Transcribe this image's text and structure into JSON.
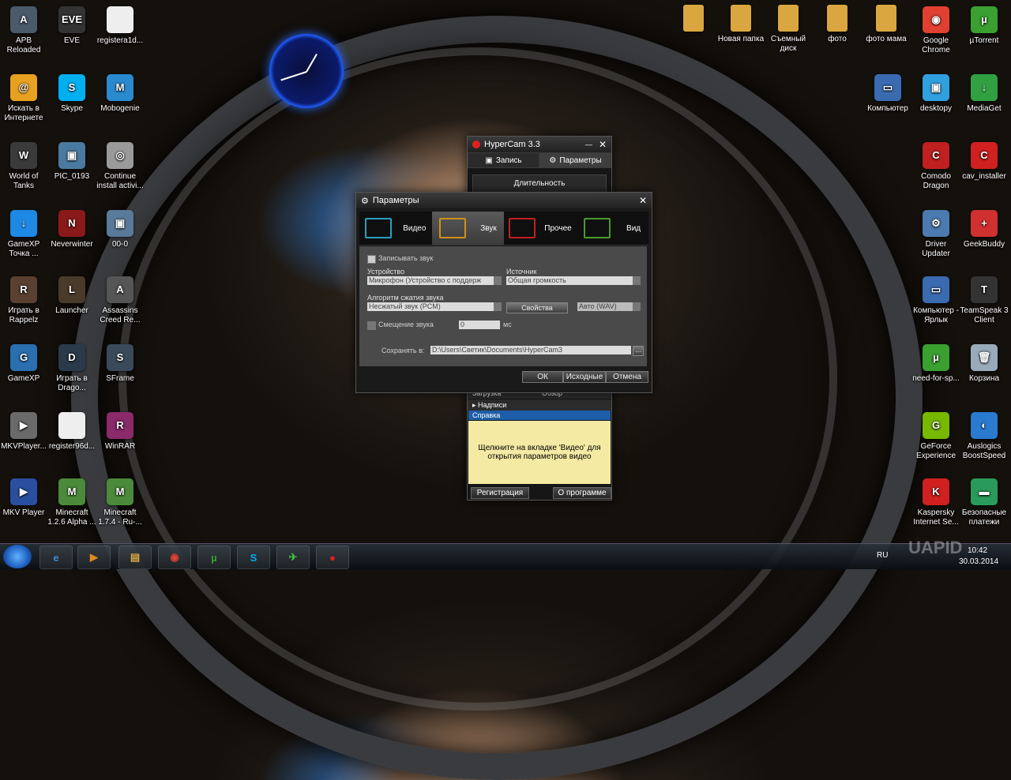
{
  "desktop": {
    "icons_left": [
      {
        "label": "APB Reloaded",
        "color": "#4a5a6a",
        "glyph": "A"
      },
      {
        "label": "Искать в Интернете",
        "color": "#e8a020",
        "glyph": "@"
      },
      {
        "label": "World of Tanks",
        "color": "#3a3a3a",
        "glyph": "W"
      },
      {
        "label": "GameXP Точка ...",
        "color": "#1e88e5",
        "glyph": "↓"
      },
      {
        "label": "Играть в Rappelz",
        "color": "#5a4030",
        "glyph": "R"
      },
      {
        "label": "GameXP",
        "color": "#2a6fb0",
        "glyph": "G"
      },
      {
        "label": "MKVPlayer...",
        "color": "#6a6a6a",
        "glyph": "▶"
      },
      {
        "label": "MKV Player",
        "color": "#2a4fa0",
        "glyph": "▶"
      }
    ],
    "icons_col2": [
      {
        "label": "EVE",
        "color": "#333",
        "glyph": "EVE"
      },
      {
        "label": "Skype",
        "color": "#00aff0",
        "glyph": "S"
      },
      {
        "label": "PIC_0193",
        "color": "#4a7aa0",
        "glyph": "▣"
      },
      {
        "label": "Neverwinter",
        "color": "#8a1a1a",
        "glyph": "N"
      },
      {
        "label": "Launcher",
        "color": "#4a3a2a",
        "glyph": "L"
      },
      {
        "label": "Играть в Drago...",
        "color": "#2a3a4a",
        "glyph": "D"
      },
      {
        "label": "register96d...",
        "color": "#eeeeee",
        "glyph": ""
      },
      {
        "label": "Minecraft 1.2.6 Alpha ...",
        "color": "#4a8a3a",
        "glyph": "M"
      }
    ],
    "icons_col3": [
      {
        "label": "registera1d...",
        "color": "#eeeeee",
        "glyph": ""
      },
      {
        "label": "Mobogenie",
        "color": "#2a8ad0",
        "glyph": "M"
      },
      {
        "label": "Continue install activi...",
        "color": "#9a9a9a",
        "glyph": "◎"
      },
      {
        "label": "00-0",
        "color": "#5a7a9a",
        "glyph": "▣"
      },
      {
        "label": "Assassins Creed Re...",
        "color": "#555",
        "glyph": "A"
      },
      {
        "label": "SFrame",
        "color": "#3a4a5a",
        "glyph": "S"
      },
      {
        "label": "WinRAR",
        "color": "#8a2a6a",
        "glyph": "R"
      },
      {
        "label": "Minecraft 1.7.4 - Ru-...",
        "color": "#4a8a3a",
        "glyph": "M"
      }
    ],
    "icons_top": [
      {
        "label": "",
        "color": "#d9a640"
      },
      {
        "label": "Новая папка",
        "color": "#d9a640"
      },
      {
        "label": "Съемный диск",
        "color": "#d9a640"
      },
      {
        "label": "фото",
        "color": "#d9a640"
      },
      {
        "label": "фото мама",
        "color": "#d9a640"
      }
    ],
    "icons_right1": [
      {
        "label": "Google Chrome",
        "color": "#e04030",
        "glyph": "◉"
      },
      {
        "label": "desktopy",
        "color": "#30a0e0",
        "glyph": "▣"
      },
      {
        "label": "Comodo Dragon",
        "color": "#c02020",
        "glyph": "C"
      },
      {
        "label": "Driver Updater",
        "color": "#4a7ab0",
        "glyph": "⚙"
      },
      {
        "label": "Компьютер - Ярлык",
        "color": "#3a6ab0",
        "glyph": "▭"
      },
      {
        "label": "need-for-sp...",
        "color": "#3aa030",
        "glyph": "µ"
      },
      {
        "label": "GeForce Experience",
        "color": "#76b900",
        "glyph": "G"
      },
      {
        "label": "Kaspersky Internet Se...",
        "color": "#d02020",
        "glyph": "K"
      }
    ],
    "icons_right2": [
      {
        "label": "µTorrent",
        "color": "#3aa030",
        "glyph": "µ"
      },
      {
        "label": "MediaGet",
        "color": "#30a040",
        "glyph": "↓"
      },
      {
        "label": "cav_installer",
        "color": "#d02020",
        "glyph": "C"
      },
      {
        "label": "GeekBuddy",
        "color": "#d03030",
        "glyph": "+"
      },
      {
        "label": "TeamSpeak 3 Client",
        "color": "#333",
        "glyph": "T"
      },
      {
        "label": "Корзина",
        "color": "#9ab",
        "glyph": "🗑"
      },
      {
        "label": "Auslogics BoostSpeed",
        "color": "#2a7ad0",
        "glyph": "◐"
      },
      {
        "label": "Безопасные платежи",
        "color": "#2a9a5a",
        "glyph": "▬"
      }
    ],
    "computer_icon": {
      "label": "Компьютер",
      "color": "#3a6ab0"
    }
  },
  "hypercam": {
    "title": "HyperCam 3.3",
    "close": "✕",
    "min": "—",
    "tab_record": "Запись",
    "tab_params": "Параметры",
    "duration": "Длительность",
    "section_load": "Загрузка",
    "section_review": "Обзор",
    "section_captions": "Надписи",
    "help_header": "Справка",
    "help_text": "Щелкните на вкладке 'Видео' для открытия параметров видео",
    "btn_register": "Регистрация",
    "btn_about": "О программе"
  },
  "params": {
    "title": "Параметры",
    "close": "✕",
    "tabs": [
      {
        "label": "Видео",
        "color": "#2aa0c0",
        "active": false
      },
      {
        "label": "Звук",
        "color": "#d0901a",
        "active": true
      },
      {
        "label": "Прочее",
        "color": "#c02020",
        "active": false
      },
      {
        "label": "Вид",
        "color": "#4a9a2a",
        "active": false
      }
    ],
    "record_sound": "Записывать звук",
    "device_label": "Устройство",
    "device_value": "Микрофон (Устройство с поддерж",
    "source_label": "Источник",
    "source_value": "Общая громкость",
    "codec_label": "Алгоритм сжатия звука",
    "codec_value": "Несжатый звук (PCM)",
    "props_btn": "Свойства",
    "format_value": "Авто (WAV)",
    "offset_label": "Смещение звука",
    "offset_value": "0",
    "offset_unit": "мс",
    "save_label": "Сохранять в:",
    "save_path": "D:\\Users\\Светик\\Documents\\HyperCam3",
    "browse": "...",
    "btn_ok": "ОК",
    "btn_default": "Исходные",
    "btn_cancel": "Отмена"
  },
  "taskbar": {
    "lang": "RU",
    "time": "10:42",
    "date": "30.03.2014",
    "watermark": "UAPID"
  }
}
